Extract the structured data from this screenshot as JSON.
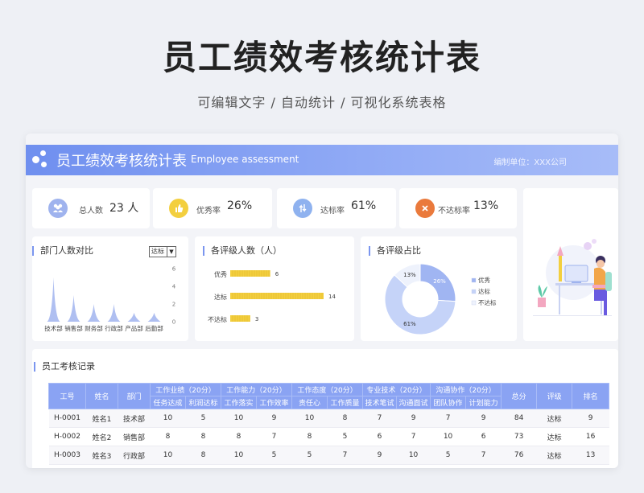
{
  "hero": {
    "title": "员工绩效考核统计表",
    "subtitle": "可编辑文字 / 自动统计 / 可视化系统表格"
  },
  "banner": {
    "title": "员工绩效考核统计表",
    "english": "Employee assessment",
    "unit": "编制单位：XXX公司"
  },
  "stats": [
    {
      "icon": "people-icon",
      "label": "总人数",
      "value": "23 人",
      "color": "#9fb3ee"
    },
    {
      "icon": "thumb-up-icon",
      "label": "优秀率",
      "value": "26%",
      "color": "#f3cf3f"
    },
    {
      "icon": "arrows-icon",
      "label": "达标率",
      "value": "61%",
      "color": "#8fb2ef"
    },
    {
      "icon": "close-icon",
      "label": "不达标率",
      "value": "13%",
      "color": "#ea7a3c"
    }
  ],
  "sections": {
    "dept": "部门人数对比",
    "dept_select": "达标",
    "grade_count": "各评级人数（人）",
    "grade_share": "各评级占比",
    "records": "员工考核记录"
  },
  "chart_data": [
    {
      "type": "area",
      "categories": [
        "技术部",
        "销售部",
        "财务部",
        "行政部",
        "产品部",
        "后勤部"
      ],
      "series": [
        {
          "values": [
            5,
            3,
            2,
            2,
            1,
            1
          ]
        }
      ],
      "ylim": [
        0,
        6
      ],
      "yticks": [
        0,
        2,
        4,
        6
      ],
      "grid": false,
      "color": "#a6b8f0"
    },
    {
      "type": "bar",
      "orientation": "horizontal",
      "categories": [
        "优秀",
        "达标",
        "不达标"
      ],
      "values": [
        6,
        14,
        3
      ],
      "color": "#f3cf3f"
    },
    {
      "type": "pie",
      "donut": true,
      "categories": [
        "优秀",
        "达标",
        "不达标"
      ],
      "values": [
        26,
        61,
        13
      ],
      "labels": [
        "26%",
        "61%",
        "13%"
      ],
      "colors": [
        "#a0b5f2",
        "#c5d3f8",
        "#eef2fc"
      ],
      "legend": "right"
    }
  ],
  "table": {
    "group_headers": [
      {
        "label": "工作业绩（20分）",
        "span": 2
      },
      {
        "label": "工作能力（20分）",
        "span": 2
      },
      {
        "label": "工作态度（20分）",
        "span": 2
      },
      {
        "label": "专业技术（20分）",
        "span": 2
      },
      {
        "label": "沟通协作（20分）",
        "span": 2
      }
    ],
    "fixed_headers_left": [
      "工号",
      "姓名",
      "部门"
    ],
    "fixed_headers_right": [
      "总分",
      "评级",
      "排名"
    ],
    "sub_headers": [
      "任务达成",
      "利润达标",
      "工作落实",
      "工作效率",
      "责任心",
      "工作质量",
      "技术笔试",
      "沟通面试",
      "团队协作",
      "计划能力"
    ],
    "rows": [
      [
        "H-0001",
        "姓名1",
        "技术部",
        "10",
        "5",
        "10",
        "9",
        "10",
        "8",
        "7",
        "9",
        "7",
        "9",
        "84",
        "达标",
        "9"
      ],
      [
        "H-0002",
        "姓名2",
        "销售部",
        "8",
        "8",
        "8",
        "7",
        "8",
        "5",
        "6",
        "7",
        "10",
        "6",
        "73",
        "达标",
        "16"
      ],
      [
        "H-0003",
        "姓名3",
        "行政部",
        "10",
        "8",
        "10",
        "5",
        "5",
        "7",
        "9",
        "10",
        "5",
        "7",
        "76",
        "达标",
        "13"
      ]
    ]
  }
}
